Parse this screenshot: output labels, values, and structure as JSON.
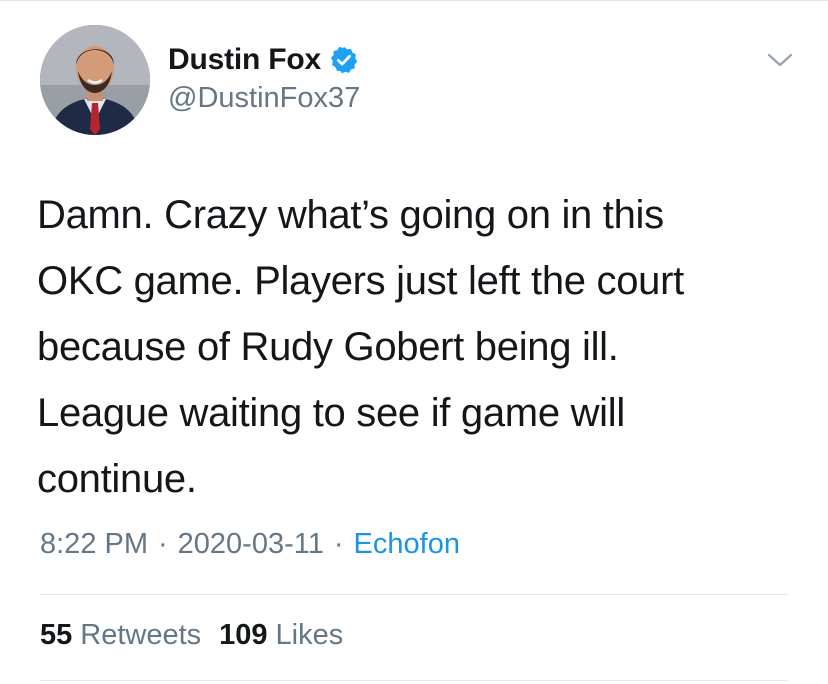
{
  "author": {
    "display_name": "Dustin Fox",
    "handle": "@DustinFox37",
    "verified": true
  },
  "icons": {
    "verified": "verified-badge-icon",
    "more": "chevron-down-icon"
  },
  "tweet": {
    "text": "Damn. Crazy what’s going on in this\nOKC game. Players just left the court\nbecause of Rudy Gobert being ill.\nLeague waiting to see if game will\ncontinue."
  },
  "meta": {
    "time": "8:22 PM",
    "date": "2020-03-11",
    "separator": "·",
    "source": "Echofon"
  },
  "stats": {
    "retweets_count": "55",
    "retweets_label": "Retweets",
    "likes_count": "109",
    "likes_label": "Likes"
  },
  "colors": {
    "text_primary": "#14171a",
    "text_secondary": "#657786",
    "link": "#1b95e0",
    "verified": "#1da1f2",
    "divider": "#e1e8ed"
  }
}
